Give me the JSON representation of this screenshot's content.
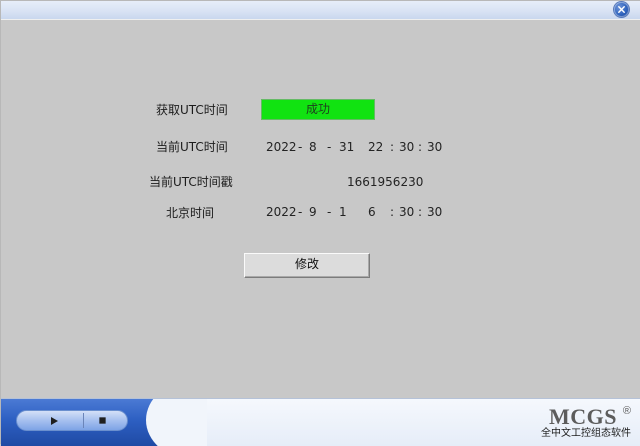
{
  "window": {
    "title_close_icon": "close-icon"
  },
  "status_row": {
    "label": "获取UTC时间",
    "value": "成功",
    "value_color": "#11E311"
  },
  "utc_row": {
    "label": "当前UTC时间",
    "year": "2022",
    "month": "8",
    "day": "31",
    "hour": "22",
    "minute": "30",
    "second": "30"
  },
  "timestamp_row": {
    "label": "当前UTC时间戳",
    "value": "1661956230"
  },
  "beijing_row": {
    "label": "北京时间",
    "year": "2022",
    "month": "9",
    "day": "1",
    "hour": "6",
    "minute": "30",
    "second": "30"
  },
  "buttons": {
    "modify_label": "修改"
  },
  "footer": {
    "play_icon": "play-icon",
    "stop_icon": "stop-icon",
    "brand": "MCGS",
    "brand_reg": "®",
    "brand_subtitle": "全中文工控组态软件"
  },
  "colors": {
    "background": "#C8C8C8",
    "accent": "#2D5FC2"
  }
}
